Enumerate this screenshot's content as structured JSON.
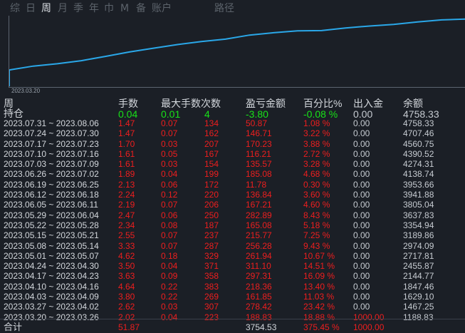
{
  "tabs": [
    {
      "label": "综",
      "active": false
    },
    {
      "label": "日",
      "active": false
    },
    {
      "label": "周",
      "active": true
    },
    {
      "label": "月",
      "active": false
    },
    {
      "label": "季",
      "active": false
    },
    {
      "label": "年",
      "active": false
    },
    {
      "label": "巾",
      "active": false
    },
    {
      "label": "M",
      "active": false
    },
    {
      "label": "备",
      "active": false
    },
    {
      "label": "账户",
      "active": false
    },
    {
      "label": "路径",
      "active": false
    }
  ],
  "chart": {
    "start_date": "2023.03.20",
    "line_color": "#2aa7e8",
    "series": [
      1188.83,
      1467.25,
      1629.1,
      1847.46,
      2144.77,
      2455.87,
      2717.81,
      2974.09,
      3189.86,
      3354.94,
      3637.83,
      3805.04,
      3941.88,
      3953.66,
      4138.74,
      4274.31,
      4390.52,
      4560.75,
      4707.46,
      4758.33
    ]
  },
  "table": {
    "headers": [
      "周",
      "手数",
      "最大手数",
      "次数",
      "盈亏金额",
      "百分比%",
      "出入金",
      "余额"
    ],
    "holding": {
      "label": "持仓",
      "lots": "0.04",
      "max_lots": "0.01",
      "count": "4",
      "pnl": "-3.80",
      "pct": "-0.08 %",
      "inout": "0.00",
      "balance": "4758.33"
    },
    "rows": [
      {
        "week": "2023.07.31 ~ 2023.08.06",
        "lots": "1.47",
        "max_lots": "0.07",
        "count": "134",
        "pnl": "50.87",
        "pct": "1.08 %",
        "inout": "0.00",
        "balance": "4758.33"
      },
      {
        "week": "2023.07.24 ~ 2023.07.30",
        "lots": "1.47",
        "max_lots": "0.07",
        "count": "162",
        "pnl": "146.71",
        "pct": "3.22 %",
        "inout": "0.00",
        "balance": "4707.46"
      },
      {
        "week": "2023.07.17 ~ 2023.07.23",
        "lots": "1.70",
        "max_lots": "0.03",
        "count": "207",
        "pnl": "170.23",
        "pct": "3.88 %",
        "inout": "0.00",
        "balance": "4560.75"
      },
      {
        "week": "2023.07.10 ~ 2023.07.16",
        "lots": "1.61",
        "max_lots": "0.05",
        "count": "167",
        "pnl": "116.21",
        "pct": "2.72 %",
        "inout": "0.00",
        "balance": "4390.52"
      },
      {
        "week": "2023.07.03 ~ 2023.07.09",
        "lots": "1.61",
        "max_lots": "0.03",
        "count": "154",
        "pnl": "135.57",
        "pct": "3.28 %",
        "inout": "0.00",
        "balance": "4274.31"
      },
      {
        "week": "2023.06.26 ~ 2023.07.02",
        "lots": "1.89",
        "max_lots": "0.04",
        "count": "199",
        "pnl": "185.08",
        "pct": "4.68 %",
        "inout": "0.00",
        "balance": "4138.74"
      },
      {
        "week": "2023.06.19 ~ 2023.06.25",
        "lots": "2.13",
        "max_lots": "0.06",
        "count": "172",
        "pnl": "11.78",
        "pct": "0.30 %",
        "inout": "0.00",
        "balance": "3953.66"
      },
      {
        "week": "2023.06.12 ~ 2023.06.18",
        "lots": "2.24",
        "max_lots": "0.12",
        "count": "220",
        "pnl": "136.84",
        "pct": "3.60 %",
        "inout": "0.00",
        "balance": "3941.88"
      },
      {
        "week": "2023.06.05 ~ 2023.06.11",
        "lots": "2.19",
        "max_lots": "0.07",
        "count": "206",
        "pnl": "167.21",
        "pct": "4.60 %",
        "inout": "0.00",
        "balance": "3805.04"
      },
      {
        "week": "2023.05.29 ~ 2023.06.04",
        "lots": "2.47",
        "max_lots": "0.06",
        "count": "250",
        "pnl": "282.89",
        "pct": "8.43 %",
        "inout": "0.00",
        "balance": "3637.83"
      },
      {
        "week": "2023.05.22 ~ 2023.05.28",
        "lots": "2.34",
        "max_lots": "0.08",
        "count": "187",
        "pnl": "165.08",
        "pct": "5.18 %",
        "inout": "0.00",
        "balance": "3354.94"
      },
      {
        "week": "2023.05.15 ~ 2023.05.21",
        "lots": "2.55",
        "max_lots": "0.07",
        "count": "237",
        "pnl": "215.77",
        "pct": "7.25 %",
        "inout": "0.00",
        "balance": "3189.86"
      },
      {
        "week": "2023.05.08 ~ 2023.05.14",
        "lots": "3.33",
        "max_lots": "0.07",
        "count": "287",
        "pnl": "256.28",
        "pct": "9.43 %",
        "inout": "0.00",
        "balance": "2974.09"
      },
      {
        "week": "2023.05.01 ~ 2023.05.07",
        "lots": "4.62",
        "max_lots": "0.18",
        "count": "329",
        "pnl": "261.94",
        "pct": "10.67 %",
        "inout": "0.00",
        "balance": "2717.81"
      },
      {
        "week": "2023.04.24 ~ 2023.04.30",
        "lots": "3.50",
        "max_lots": "0.04",
        "count": "371",
        "pnl": "311.10",
        "pct": "14.51 %",
        "inout": "0.00",
        "balance": "2455.87"
      },
      {
        "week": "2023.04.17 ~ 2023.04.23",
        "lots": "3.63",
        "max_lots": "0.09",
        "count": "358",
        "pnl": "297.31",
        "pct": "16.09 %",
        "inout": "0.00",
        "balance": "2144.77"
      },
      {
        "week": "2023.04.10 ~ 2023.04.16",
        "lots": "4.64",
        "max_lots": "0.22",
        "count": "383",
        "pnl": "218.36",
        "pct": "13.40 %",
        "inout": "0.00",
        "balance": "1847.46"
      },
      {
        "week": "2023.04.03 ~ 2023.04.09",
        "lots": "3.80",
        "max_lots": "0.22",
        "count": "269",
        "pnl": "161.85",
        "pct": "11.03 %",
        "inout": "0.00",
        "balance": "1629.10"
      },
      {
        "week": "2023.03.27 ~ 2023.04.02",
        "lots": "2.62",
        "max_lots": "0.03",
        "count": "307",
        "pnl": "278.42",
        "pct": "23.42 %",
        "inout": "0.00",
        "balance": "1467.25"
      },
      {
        "week": "2023.03.20 ~ 2023.03.26",
        "lots": "2.02",
        "max_lots": "0.04",
        "count": "223",
        "pnl": "188.83",
        "pct": "18.88 %",
        "inout": "1000.00",
        "balance": "1188.83"
      }
    ],
    "total": {
      "label": "合计",
      "lots": "51.87",
      "pnl": "3754.53",
      "pct": "375.45 %",
      "inout": "1000.00"
    }
  }
}
